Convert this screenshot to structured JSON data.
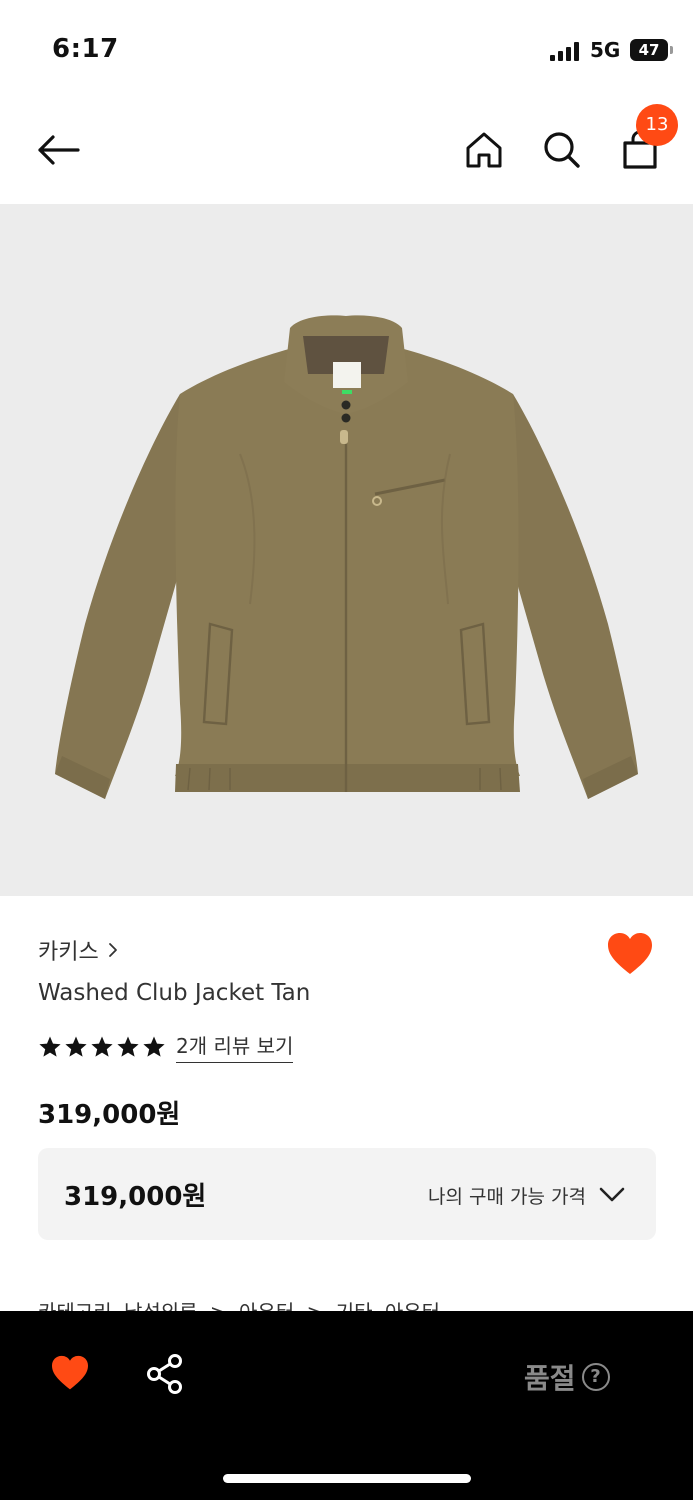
{
  "status_bar": {
    "time": "6:17",
    "network": "5G",
    "battery": "47"
  },
  "nav": {
    "back_icon": "arrow-left-icon",
    "home_icon": "home-icon",
    "search_icon": "search-icon",
    "cart_icon": "shopping-bag-icon",
    "cart_count": "13"
  },
  "product": {
    "brand": "카키스",
    "name": "Washed Club Jacket Tan",
    "rating_stars": 5,
    "review_link": "2개 리뷰 보기",
    "price": "319,000원",
    "liked": true,
    "price_box": {
      "price": "319,000원",
      "label": "나의 구매 가능 가격"
    },
    "category_peek": "카테고리 남성의류 > 아우터 > 기타 아우터"
  },
  "bottom_bar": {
    "like_icon": "heart-icon",
    "share_icon": "share-icon",
    "soldout_label": "품절",
    "help_icon": "question-circle-icon"
  },
  "colors": {
    "accent": "#ff4a14",
    "bottom_bar": "#000000",
    "hero_bg": "#ececec",
    "jacket": "#8a7b55"
  }
}
